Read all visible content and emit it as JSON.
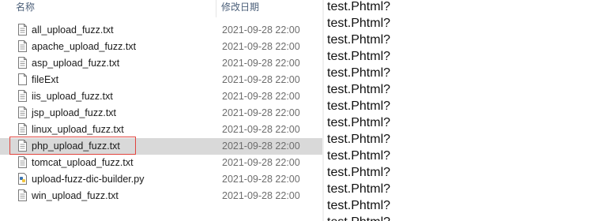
{
  "explorer": {
    "columns": {
      "name": "名称",
      "modified": "修改日期"
    },
    "files": [
      {
        "name": "all_upload_fuzz.txt",
        "modified": "2021-09-28 22:00",
        "icon": "text-file-icon"
      },
      {
        "name": "apache_upload_fuzz.txt",
        "modified": "2021-09-28 22:00",
        "icon": "text-file-icon"
      },
      {
        "name": "asp_upload_fuzz.txt",
        "modified": "2021-09-28 22:00",
        "icon": "text-file-icon"
      },
      {
        "name": "fileExt",
        "modified": "2021-09-28 22:00",
        "icon": "blank-file-icon"
      },
      {
        "name": "iis_upload_fuzz.txt",
        "modified": "2021-09-28 22:00",
        "icon": "text-file-icon"
      },
      {
        "name": "jsp_upload_fuzz.txt",
        "modified": "2021-09-28 22:00",
        "icon": "text-file-icon"
      },
      {
        "name": "linux_upload_fuzz.txt",
        "modified": "2021-09-28 22:00",
        "icon": "text-file-icon"
      },
      {
        "name": "php_upload_fuzz.txt",
        "modified": "2021-09-28 22:00",
        "icon": "text-file-icon",
        "selected": true
      },
      {
        "name": "tomcat_upload_fuzz.txt",
        "modified": "2021-09-28 22:00",
        "icon": "text-file-icon"
      },
      {
        "name": "upload-fuzz-dic-builder.py",
        "modified": "2021-09-28 22:00",
        "icon": "python-file-icon"
      },
      {
        "name": "win_upload_fuzz.txt",
        "modified": "2021-09-28 22:00",
        "icon": "text-file-icon"
      }
    ]
  },
  "file_content": {
    "lines": [
      "test.Phtml?",
      "test.Phtml?",
      "test.Phtml?",
      "test.Phtml?",
      "test.Phtml?",
      "test.Phtml?",
      "test.Phtml?",
      "test.Phtml?",
      "test.Phtml?",
      "test.Phtml?",
      "test.Phtml?",
      "test.Phtml?",
      "test.Phtml?",
      "test.Phtml?"
    ]
  },
  "colors": {
    "selection": "#d9d9d9",
    "highlight_border": "#e0443e",
    "header_text": "#4c607a"
  }
}
